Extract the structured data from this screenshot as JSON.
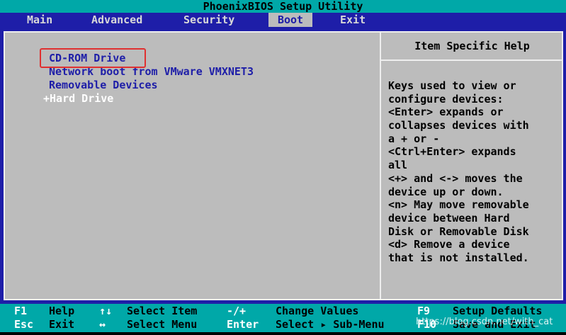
{
  "app": {
    "title": "PhoenixBIOS Setup Utility"
  },
  "menu": {
    "items": [
      {
        "label": "Main"
      },
      {
        "label": "Advanced"
      },
      {
        "label": "Security"
      },
      {
        "label": "Boot"
      },
      {
        "label": "Exit"
      }
    ],
    "active": "Boot"
  },
  "boot": {
    "items": [
      {
        "label": "CD-ROM Drive"
      },
      {
        "label": "Network boot from VMware VMXNET3"
      },
      {
        "label": "Removable Devices"
      },
      {
        "label": "+Hard Drive"
      }
    ]
  },
  "help": {
    "title": "Item Specific Help",
    "lines": [
      "Keys used to view or",
      "configure devices:",
      "<Enter> expands or",
      "collapses devices with",
      "a + or -",
      "<Ctrl+Enter> expands",
      "all",
      "<+> and <-> moves the",
      "device up or down.",
      "<n> May move removable",
      "device between Hard",
      "Disk or Removable Disk",
      "<d> Remove a device",
      "that is not installed."
    ]
  },
  "footer": {
    "row1": [
      {
        "key": "F1",
        "desc": "Help"
      },
      {
        "key": "↑↓",
        "desc": "Select Item"
      },
      {
        "key": "-/+",
        "desc": "Change Values"
      },
      {
        "key": "F9",
        "desc": "Setup Defaults"
      }
    ],
    "row2": [
      {
        "key": "Esc",
        "desc": "Exit"
      },
      {
        "key": "↔",
        "desc": "Select Menu"
      },
      {
        "key": "Enter",
        "desc": "Select ▸ Sub-Menu"
      },
      {
        "key": "F10",
        "desc": "Save and Exit"
      }
    ]
  },
  "watermark": "https://blog.csdn.net/with_cat",
  "colors": {
    "background": "#1e1ea8",
    "panel": "#bcbcbc",
    "accent": "#00a8a8",
    "highlight_border": "#e03030"
  }
}
